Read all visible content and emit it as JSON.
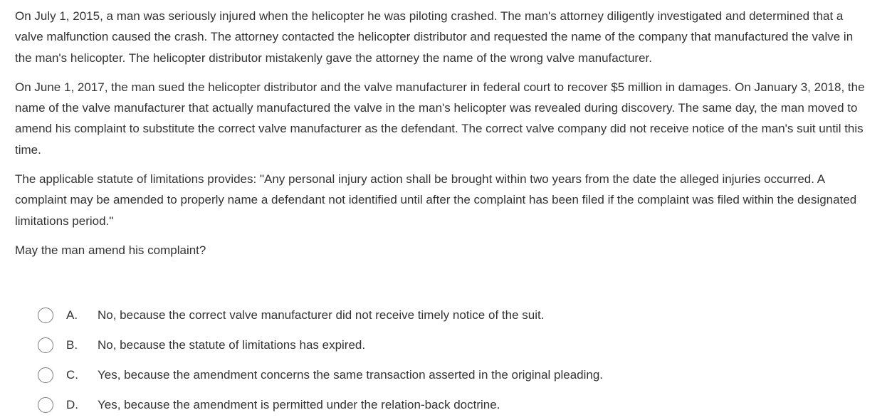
{
  "question": {
    "paragraphs": [
      "On July 1, 2015, a man was seriously injured when the helicopter he was piloting crashed.  The man's attorney diligently investigated and determined that a valve malfunction caused the crash.  The attorney contacted the helicopter distributor and requested the name of the company that manufactured the valve in the man's helicopter.  The helicopter distributor mistakenly gave the attorney the name of the wrong valve manufacturer.",
      "On June 1, 2017, the man sued the helicopter distributor and the valve manufacturer in federal court to recover $5 million in damages.  On January 3, 2018, the name of the valve manufacturer that actually manufactured the valve in the man's helicopter was revealed during discovery.  The same day, the man moved to amend his complaint to substitute the correct valve manufacturer as the defendant.  The correct valve company did not receive notice of the man's suit until this time.",
      "The applicable statute of limitations provides: \"Any personal injury action shall be brought within two years from the date the alleged injuries occurred.  A complaint may be amended to properly name a defendant not identified until after the complaint has been filed if the complaint was filed within the designated limitations period.\""
    ],
    "prompt": "May the man amend his complaint?"
  },
  "choices": [
    {
      "letter": "A.",
      "text": "No, because the correct valve manufacturer did not receive timely notice of the suit."
    },
    {
      "letter": "B.",
      "text": "No, because the statute of limitations has expired."
    },
    {
      "letter": "C.",
      "text": "Yes, because the amendment concerns the same transaction asserted in the original pleading."
    },
    {
      "letter": "D.",
      "text": "Yes, because the amendment is permitted under the relation-back doctrine."
    }
  ]
}
